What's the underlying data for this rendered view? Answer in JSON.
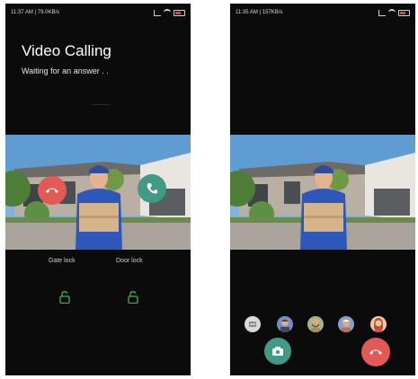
{
  "left_screen": {
    "status_bar": {
      "time_speed": "11:37 AM | 79.0KB/s"
    },
    "title": "Video Calling",
    "subtitle": "Waiting for an answer . .",
    "locks": [
      {
        "label": "Gate lock",
        "icon": "lock-open-icon"
      },
      {
        "label": "Door lock",
        "icon": "lock-open-icon"
      }
    ],
    "buttons": {
      "reject": "phone-hangup-icon",
      "accept": "phone-answer-icon"
    }
  },
  "right_screen": {
    "status_bar": {
      "time_speed": "11:35 AM | 157KB/s"
    },
    "voice_changer_options": [
      {
        "name": "robot-avatar-icon"
      },
      {
        "name": "man-avatar-icon"
      },
      {
        "name": "bearded-man-avatar-icon"
      },
      {
        "name": "old-man-avatar-icon"
      },
      {
        "name": "woman-avatar-icon"
      }
    ],
    "buttons": {
      "camera": "camera-icon",
      "hangup": "phone-hangup-icon"
    }
  },
  "colors": {
    "reject": "#e15a56",
    "accept": "#3f9a86",
    "lock": "#3fb24a",
    "background": "#0b0b0b"
  }
}
